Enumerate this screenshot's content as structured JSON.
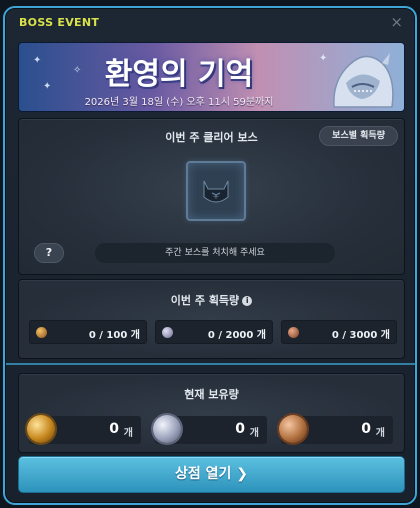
{
  "window": {
    "title": "BOSS EVENT",
    "close_glyph": "×"
  },
  "banner": {
    "title": "환영의 기억",
    "date": "2026년 3월 18일 (수) 오후 11시 59분까지",
    "figure_icon": "hooded-creature-icon"
  },
  "clear_boss": {
    "title": "이번 주 클리어 보스",
    "by_boss_button": "보스별 획득량",
    "slot_icon": "boss-emblem-icon",
    "help_label": "?",
    "hint": "주간 보스를 처치해 주세요"
  },
  "weekly_gain": {
    "title": "이번 주 획득량",
    "info_icon": "info-icon",
    "items": [
      {
        "icon": "gold-coin-icon",
        "text": "0 / 100 개",
        "color": "#c07a2a"
      },
      {
        "icon": "silver-coin-icon",
        "text": "0 / 2000 개",
        "color": "#a8a6c8"
      },
      {
        "icon": "bronze-coin-icon",
        "text": "0 / 3000 개",
        "color": "#b06a4a"
      }
    ]
  },
  "holdings": {
    "title": "현재 보유량",
    "items": [
      {
        "icon": "gold-medal-icon",
        "value": "0",
        "unit": "개",
        "color": "#d49a2a"
      },
      {
        "icon": "silver-medal-icon",
        "value": "0",
        "unit": "개",
        "color": "#a8b0c4"
      },
      {
        "icon": "bronze-medal-icon",
        "value": "0",
        "unit": "개",
        "color": "#b87a4e"
      }
    ]
  },
  "shop_button": {
    "label": "상점 열기 ❯"
  },
  "colors": {
    "accent": "#3fa5d6",
    "title": "#d9e24a",
    "shop_button": "#3aa3cb"
  }
}
